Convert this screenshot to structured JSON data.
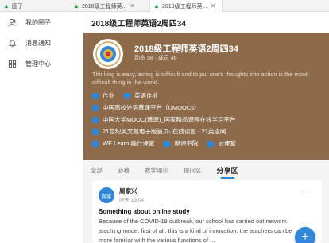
{
  "tabs": [
    {
      "label": "圈子"
    },
    {
      "label": "2018级工程师英..."
    },
    {
      "label": "2018级工程师英..."
    }
  ],
  "sidebar": {
    "items": [
      {
        "label": "我的圈子",
        "icon": "people-icon"
      },
      {
        "label": "消息通知",
        "icon": "bell-icon"
      },
      {
        "label": "管理中心",
        "icon": "grid-icon"
      }
    ]
  },
  "header": {
    "title": "2018级工程师英语2周四34"
  },
  "group": {
    "title": "2018级工程师英语2周四34",
    "stats": "动态 58 · 成员 46",
    "motto": "Thinking is easy, acting is difficult and to put one's thoughts into action is the most difficult thing in the world.",
    "links": [
      [
        {
          "label": "作业"
        },
        {
          "label": "英语作业"
        }
      ],
      [
        {
          "label": "中国高校外语慕课平台（UMOOCs）"
        }
      ],
      [
        {
          "label": "中国大学MOOC(慕课)_国家精品课程在线学习平台"
        }
      ],
      [
        {
          "label": "21世纪英文报电子版首页- 在线读报 - 21英语网"
        }
      ],
      [
        {
          "label": "WE Learn 随行课堂"
        },
        {
          "label": "摩课书院"
        },
        {
          "label": "云课堂"
        }
      ]
    ]
  },
  "section_tabs": [
    {
      "label": "全部"
    },
    {
      "label": "必看"
    },
    {
      "label": "教学通知"
    },
    {
      "label": "提问区"
    },
    {
      "label": "分享区",
      "active": true
    }
  ],
  "post": {
    "avatar_text": "周家",
    "author": "周家兴",
    "time": "昨天 19:04",
    "more": "···",
    "title": "Something about online study",
    "body": "Because of the COVID-19 outbreak, our school has carried out network teaching mode, first of all, this is a kind of innovation, the teachers can be more familiar with the various functions of ..."
  },
  "fab": {
    "label": "+"
  },
  "colors": {
    "card_bg": "#8c6a4a",
    "accent": "#2f87d6",
    "tab_icon": "#2aa356"
  }
}
